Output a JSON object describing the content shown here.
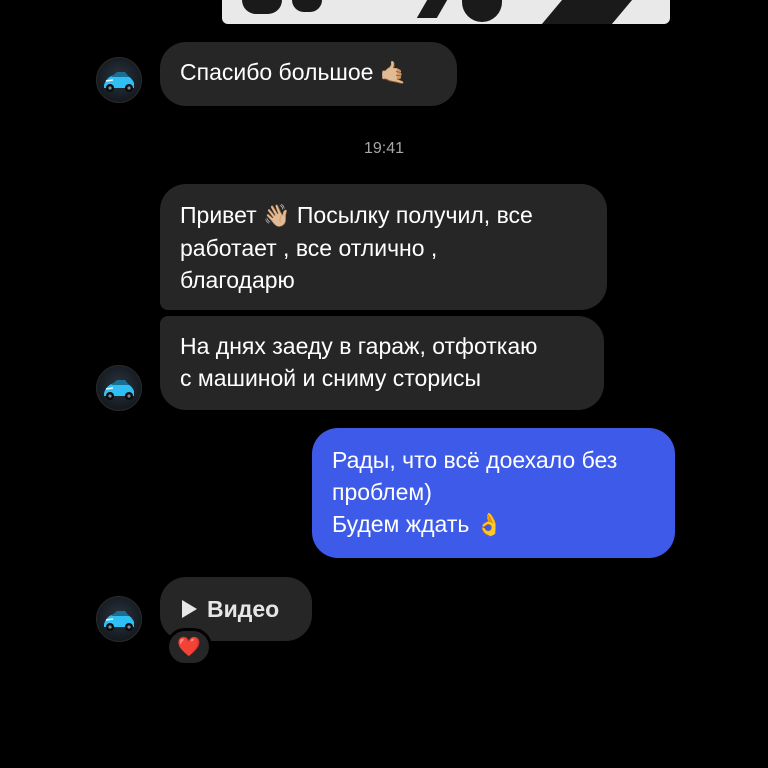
{
  "chat": {
    "timestamp": "19:41",
    "messages": [
      {
        "id": "m1",
        "direction": "incoming",
        "lines": [
          "Спасибо большое"
        ],
        "emoji": "🤙🏼"
      },
      {
        "id": "m2",
        "direction": "incoming",
        "lines": [
          "Привет",
          "Посылку получил, все",
          "работает , все отлично ,",
          "благодарю"
        ],
        "emoji": "👋🏼"
      },
      {
        "id": "m3",
        "direction": "incoming",
        "lines": [
          "На днях заеду в гараж, отфоткаю",
          "с машиной и сниму сторисы"
        ]
      },
      {
        "id": "m4",
        "direction": "outgoing",
        "lines": [
          "Рады, что всё доехало без",
          "проблем)",
          "Будем ждать"
        ],
        "emoji": "👌"
      },
      {
        "id": "m5",
        "direction": "incoming",
        "type": "video",
        "label": "Видео",
        "reaction": "❤️"
      }
    ]
  },
  "icons": {
    "avatar": "car-avatar-icon",
    "play": "play-icon",
    "reaction": "heart-icon"
  },
  "colors": {
    "background": "#000000",
    "incoming_bubble": "#262626",
    "outgoing_bubble": "#3d5be8",
    "timestamp": "#a8a8a8"
  }
}
